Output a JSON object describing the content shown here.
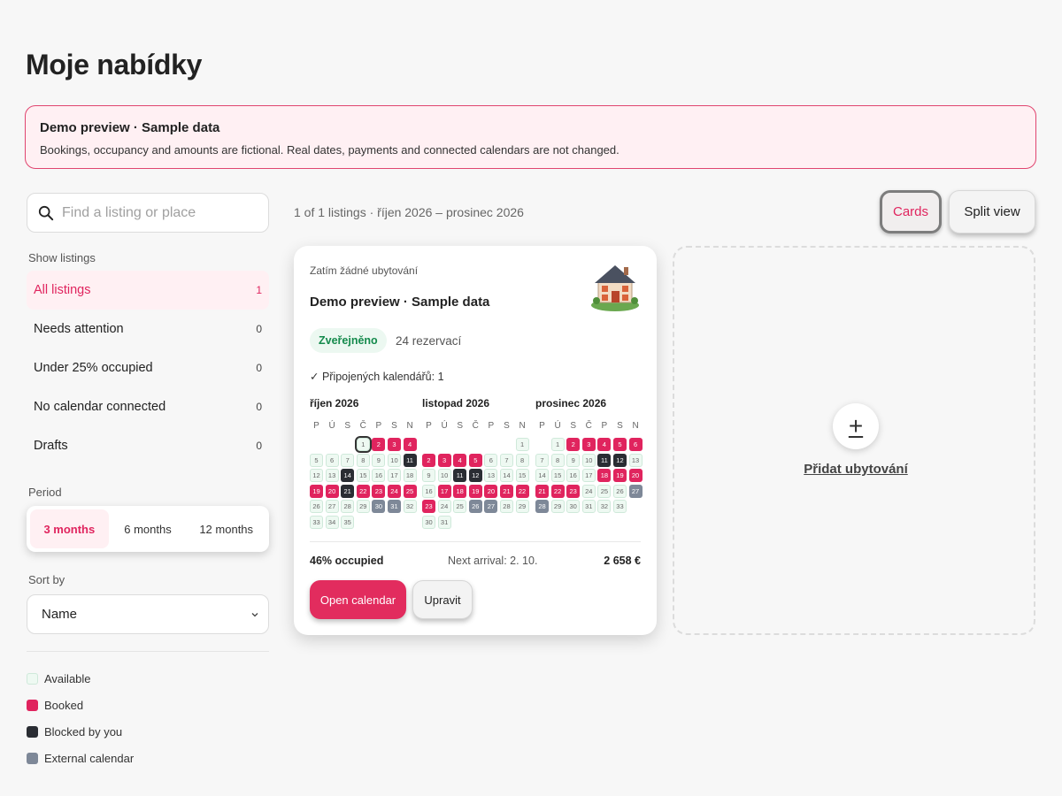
{
  "page": {
    "title": "Moje nabídky"
  },
  "banner": {
    "title": "Demo preview · Sample data",
    "text": "Bookings, occupancy and amounts are fictional. Real dates, payments and connected calendars are not changed."
  },
  "search": {
    "placeholder": "Find a listing or place",
    "value": ""
  },
  "filters": {
    "label": "Show listings",
    "items": [
      {
        "label": "All listings",
        "count": "1",
        "active": true
      },
      {
        "label": "Needs attention",
        "count": "0",
        "active": false
      },
      {
        "label": "Under 25% occupied",
        "count": "0",
        "active": false
      },
      {
        "label": "No calendar connected",
        "count": "0",
        "active": false
      },
      {
        "label": "Drafts",
        "count": "0",
        "active": false
      }
    ]
  },
  "period": {
    "label": "Period",
    "options": [
      {
        "label": "3 months",
        "active": true
      },
      {
        "label": "6 months",
        "active": false
      },
      {
        "label": "12 months",
        "active": false
      }
    ]
  },
  "sort": {
    "label": "Sort by",
    "value": "Name"
  },
  "legend": [
    {
      "label": "Available",
      "color": "#eef9f2"
    },
    {
      "label": "Booked",
      "color": "#e0245e"
    },
    {
      "label": "Blocked by you",
      "color": "#2a2d33"
    },
    {
      "label": "External calendar",
      "color": "#7e8898"
    }
  ],
  "toolbar": {
    "count_text": "1 of 1 listings · říjen 2026 – prosinec 2026",
    "cards_label": "Cards",
    "split_label": "Split view"
  },
  "listing": {
    "subtitle": "Zatím žádné ubytování",
    "title": "Demo preview · Sample data",
    "status": "Zveřejněno",
    "reservations": "24 rezervací",
    "calendars": "✓  Připojených kalendářů: 1",
    "weekdays": [
      "P",
      "Ú",
      "S",
      "Č",
      "P",
      "S",
      "N"
    ],
    "months": [
      {
        "name": "říjen 2026",
        "offset": 3,
        "today": 1,
        "days": "aBBBaaaaaakaakaaaaBBkBBBBaaaaeeaaaa"
      },
      {
        "name": "listopad 2026",
        "offset": 6,
        "today": 0,
        "days": "aBBBBaaaaaklaaaaBBBBBBBaaeeaaaa"
      },
      {
        "name": "prosinec 2026",
        "offset": 1,
        "today": 0,
        "days": "aBBBBBaaaakkaaaaaBBBBBBaaaeeaaaaa"
      }
    ],
    "occupied": "46% occupied",
    "next_arrival": "Next arrival: 2. 10.",
    "amount": "2 658 €",
    "open_label": "Open calendar",
    "edit_label": "Upravit"
  },
  "add_listing": {
    "icon": "+",
    "label": "Přidat ubytování"
  }
}
